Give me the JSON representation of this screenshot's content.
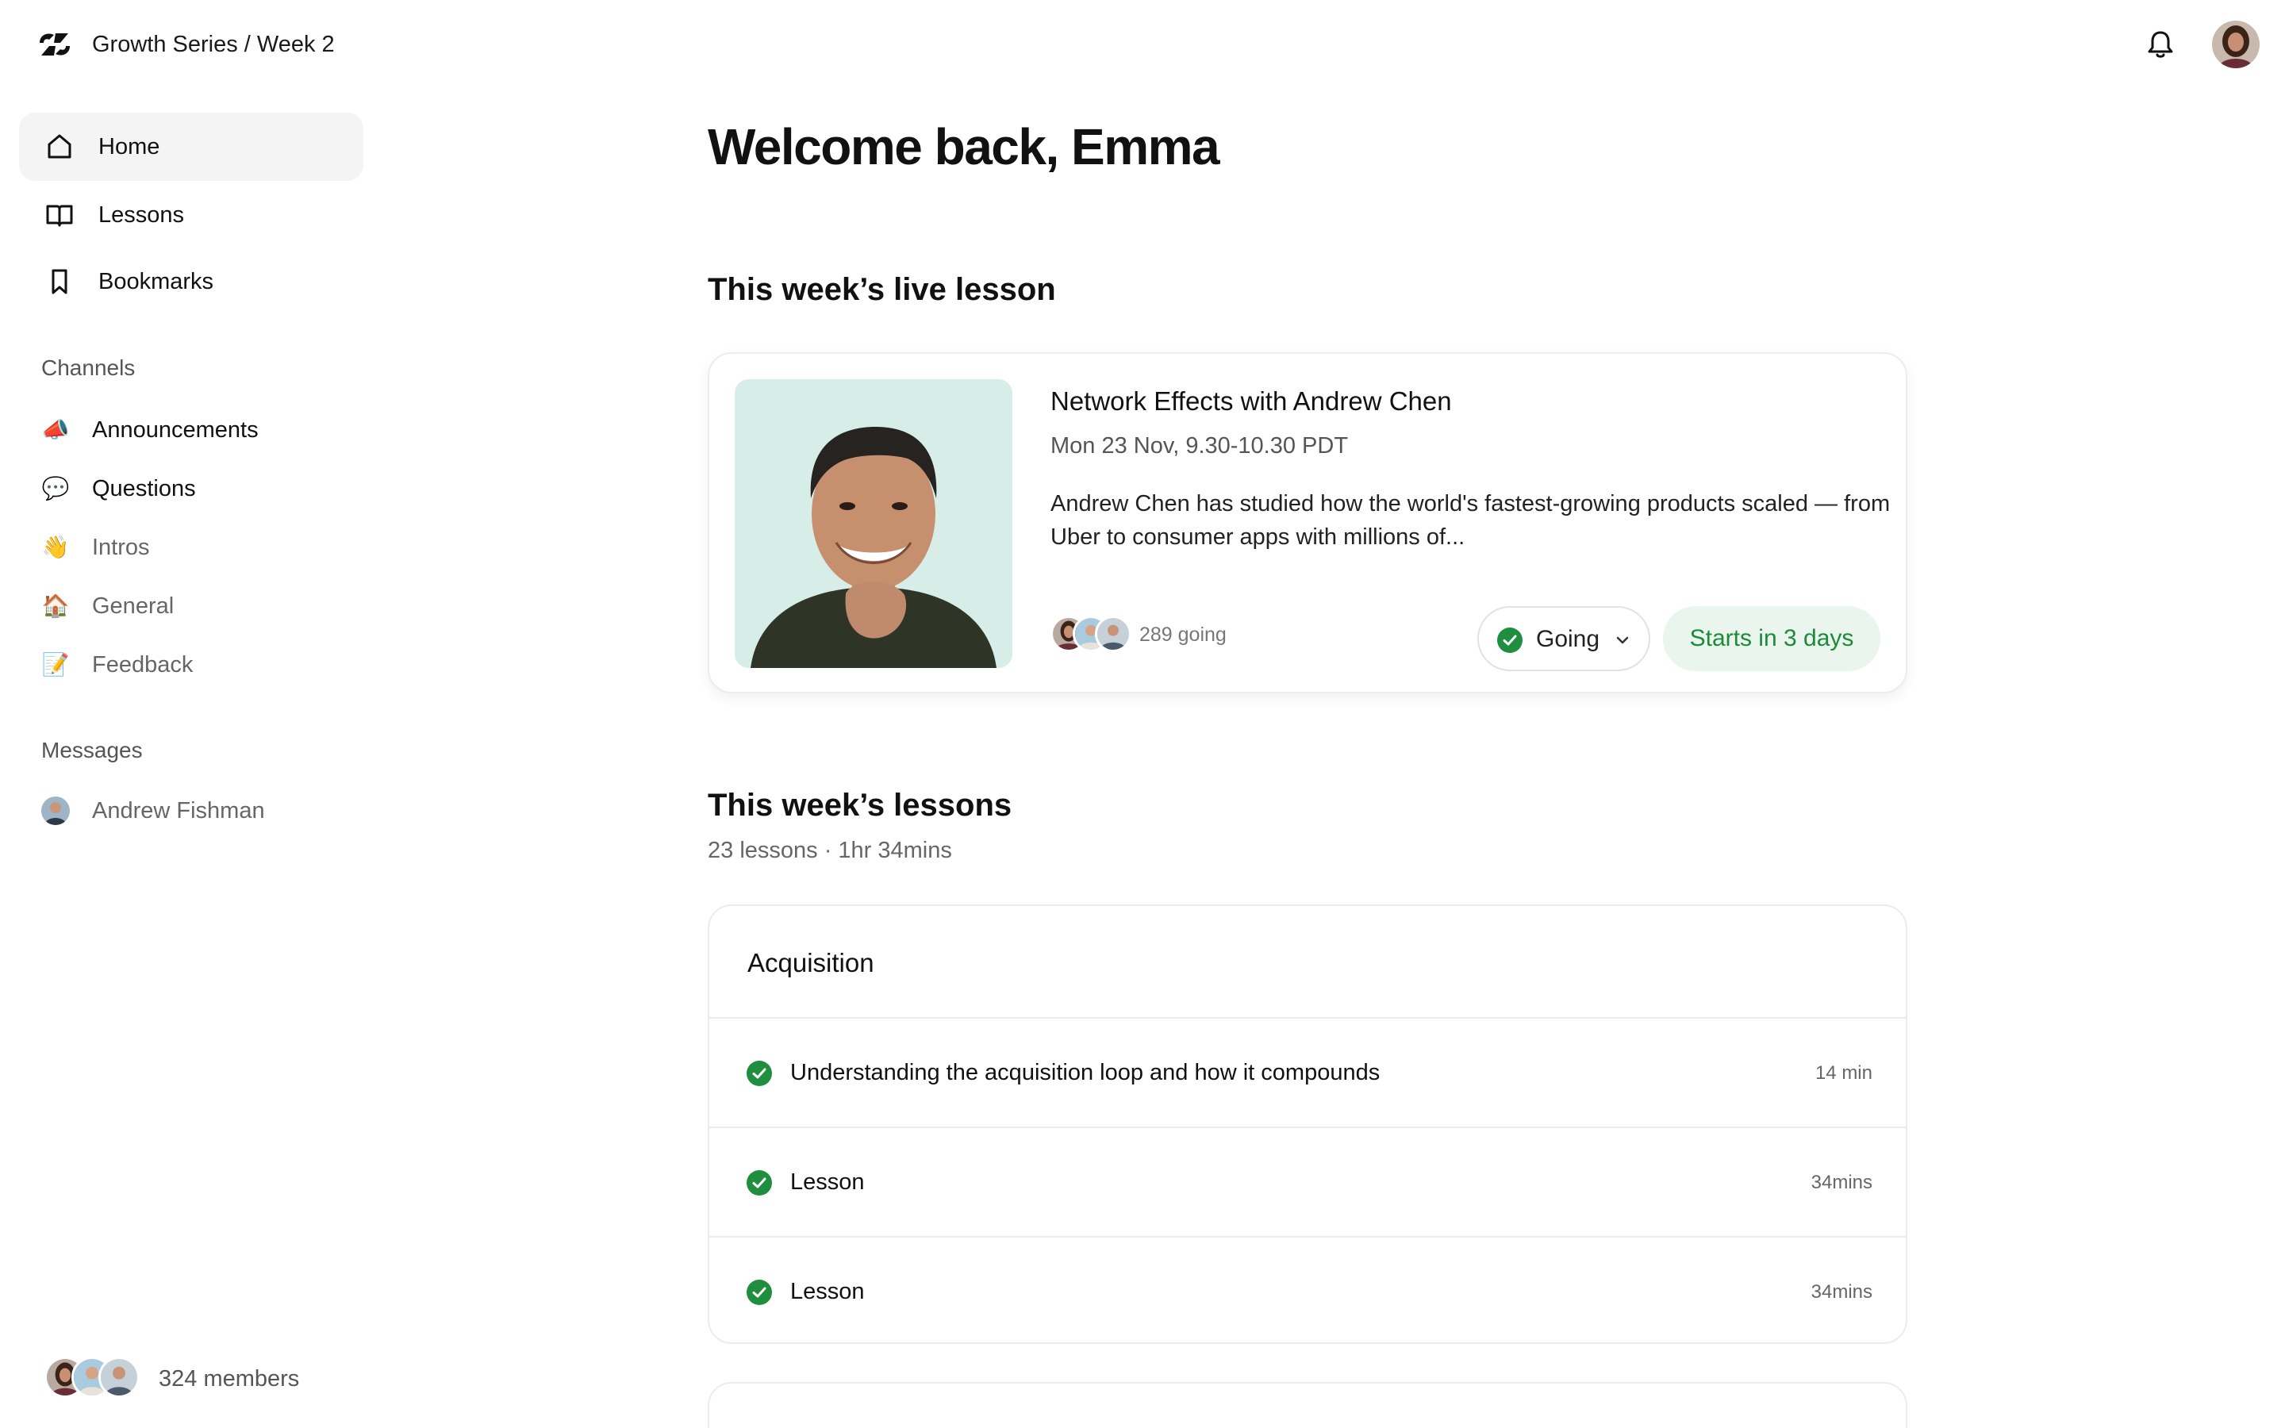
{
  "header": {
    "course_title": "Growth Series / Week 2",
    "logo_icon": "brand-logo-icon",
    "bell_icon": "bell-icon"
  },
  "sidebar": {
    "nav": [
      {
        "label": "Home",
        "icon": "home-icon",
        "active": true
      },
      {
        "label": "Lessons",
        "icon": "book-icon",
        "active": false
      },
      {
        "label": "Bookmarks",
        "icon": "bookmark-icon",
        "active": false
      }
    ],
    "channels_label": "Channels",
    "channels": [
      {
        "emoji": "📣",
        "label": "Announcements",
        "unread": true
      },
      {
        "emoji": "💬",
        "label": "Questions",
        "unread": true
      },
      {
        "emoji": "👋",
        "label": "Intros",
        "unread": false
      },
      {
        "emoji": "🏠",
        "label": "General",
        "unread": false
      },
      {
        "emoji": "📝",
        "label": "Feedback",
        "unread": false
      }
    ],
    "messages_label": "Messages",
    "messages": [
      {
        "label": "Andrew Fishman"
      }
    ],
    "members_label": "324 members"
  },
  "main": {
    "welcome": "Welcome back, Emma",
    "live_section_title": "This week’s live lesson",
    "live": {
      "title": "Network Effects with Andrew Chen",
      "time": "Mon 23 Nov, 9.30-10.30 PDT",
      "description": "Andrew Chen has studied how the world's fastest-growing products scaled — from Uber to consumer apps with millions of...",
      "going_count": "289 going",
      "going_button": "Going",
      "starts": "Starts in 3 days"
    },
    "lessons_section_title": "This week’s lessons",
    "lessons_meta": "23 lessons · 1hr 34mins",
    "lesson_group": {
      "title": "Acquisition",
      "items": [
        {
          "title": "Understanding the acquisition loop and how it compounds",
          "duration": "14 min",
          "completed": true
        },
        {
          "title": "Lesson",
          "duration": "34mins",
          "completed": true
        },
        {
          "title": "Lesson",
          "duration": "34mins",
          "completed": true
        }
      ]
    }
  },
  "colors": {
    "accent_green": "#1d8a3a",
    "check_green": "#1f8f3f",
    "pill_green_bg": "#eaf5ee",
    "active_nav_bg": "#f4f4f4",
    "border": "#ececec"
  }
}
